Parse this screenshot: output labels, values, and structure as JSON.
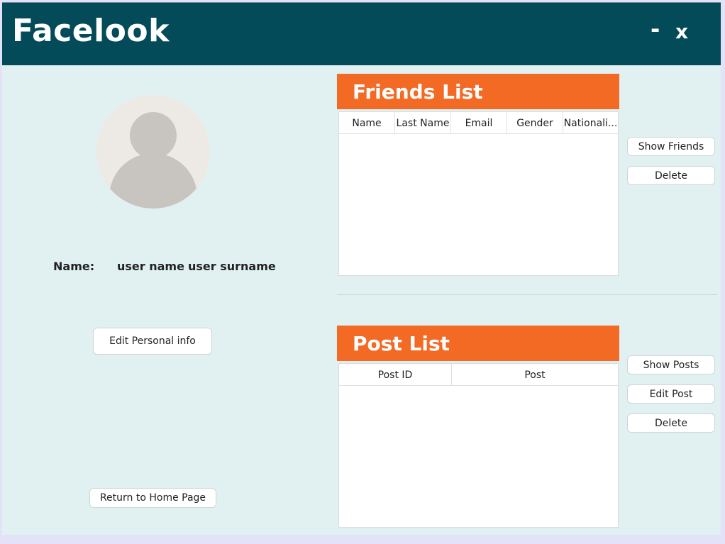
{
  "app": {
    "title": "Facelook",
    "minimize": "-",
    "close": "x"
  },
  "profile": {
    "name_label": "Name:",
    "user_name": "user name",
    "user_surname": "user surname",
    "edit_button": "Edit Personal info",
    "home_button": "Return to Home Page"
  },
  "friends": {
    "title": "Friends List",
    "columns": [
      "Name",
      "Last Name",
      "Email",
      "Gender",
      "Nationali..."
    ],
    "show_button": "Show Friends",
    "delete_button": "Delete"
  },
  "posts": {
    "title": "Post List",
    "columns": [
      "Post ID",
      "Post"
    ],
    "show_button": "Show Posts",
    "edit_button": "Edit Post",
    "delete_button": "Delete"
  },
  "colors": {
    "titlebar": "#034b58",
    "panel_header": "#f26a24",
    "background": "#e1f0f0"
  }
}
